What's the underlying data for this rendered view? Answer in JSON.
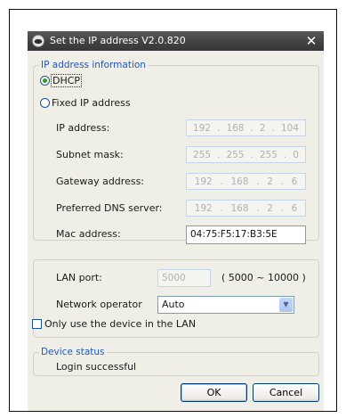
{
  "window": {
    "title": "Set the IP address   V2.0.820",
    "close_label": "✕"
  },
  "ip_group": {
    "legend": "IP address information",
    "dhcp_label": "DHCP",
    "dhcp_selected": true,
    "fixed_label": "Fixed IP address",
    "fixed_selected": false,
    "ip_label": "IP address:",
    "ip_value": [
      "192",
      "168",
      "2",
      "104"
    ],
    "subnet_label": "Subnet mask:",
    "subnet_value": [
      "255",
      "255",
      "255",
      "0"
    ],
    "gateway_label": "Gateway address:",
    "gateway_value": [
      "192",
      "168",
      "2",
      "6"
    ],
    "dns_label": "Preferred DNS server:",
    "dns_value": [
      "192",
      "168",
      "2",
      "6"
    ],
    "mac_label": "Mac address:",
    "mac_value": "04:75:F5:17:B3:5E"
  },
  "lan_group": {
    "port_label": "LAN port:",
    "port_placeholder": "5000",
    "port_range": "( 5000 ~ 10000 )",
    "operator_label": "Network operator",
    "operator_value": "Auto",
    "lan_only_label": "Only use the device in the LAN",
    "lan_only_checked": false
  },
  "status_group": {
    "legend": "Device status",
    "status_text": "Login successful"
  },
  "buttons": {
    "ok": "OK",
    "cancel": "Cancel"
  }
}
